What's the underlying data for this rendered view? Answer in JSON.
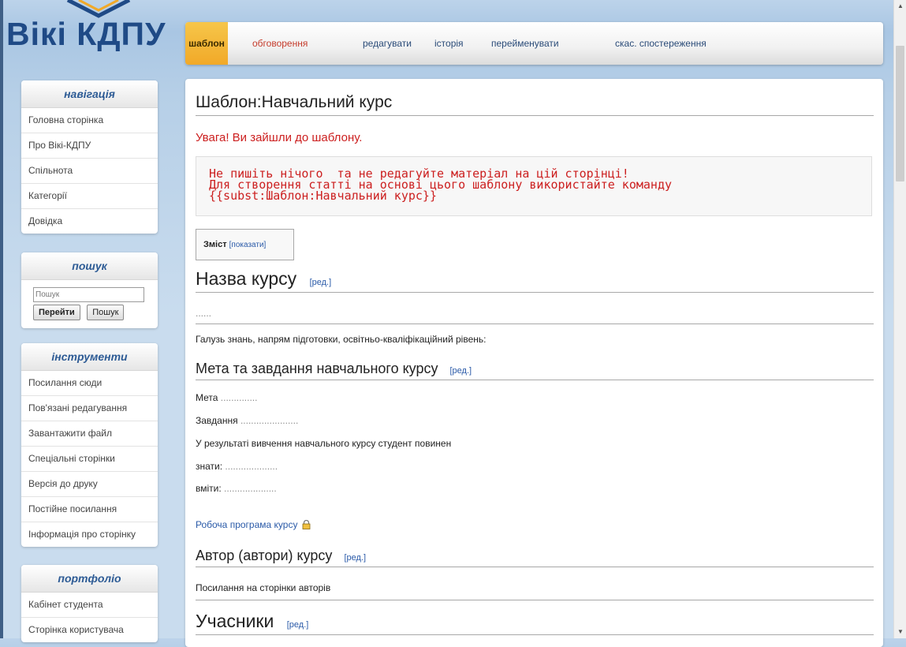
{
  "site": {
    "logo_text": "Вікі КДПУ"
  },
  "tabs": [
    {
      "label": "шаблон"
    },
    {
      "label": "обговорення"
    },
    {
      "label": "редагувати"
    },
    {
      "label": "історія"
    },
    {
      "label": "перейменувати"
    },
    {
      "label": "скас. спостереження"
    }
  ],
  "sidebar": {
    "navigation": {
      "title": "навігація",
      "items": [
        "Головна сторінка",
        "Про Вікі-КДПУ",
        "Спільнота",
        "Категорії",
        "Довідка"
      ]
    },
    "search": {
      "title": "пошук",
      "placeholder": "Пошук",
      "go_label": "Перейти",
      "search_label": "Пошук"
    },
    "tools": {
      "title": "інструменти",
      "items": [
        "Посилання сюди",
        "Пов'язані редагування",
        "Завантажити файл",
        "Спеціальні сторінки",
        "Версія до друку",
        "Постійне посилання",
        "Інформація про сторінку"
      ]
    },
    "portfolio": {
      "title": "портфоліо",
      "items": [
        "Кабінет студента",
        "Сторінка користувача"
      ]
    }
  },
  "content": {
    "title": "Шаблон:Навчальний курс",
    "warning": "Увага! Ви зайшли до шаблону.",
    "pre_lines": [
      "Не пишіть нічого  та не редагуйте матеріал на цій сторінці!",
      "Для створення статті на основі цього шаблону використайте команду",
      "{{subst:Шаблон:Навчальний курс}}"
    ],
    "toc": {
      "title": "Зміст",
      "toggle": "[показати]"
    },
    "edit_link": "[ред.]",
    "section1": {
      "heading": "Назва курсу",
      "dots": "......"
    },
    "field_line": "Галузь знань, напрям підготовки, освітньо-кваліфікаційний рівень:",
    "section2": {
      "heading": "Мета та завдання навчального курсу",
      "goal_label": "Мета",
      "goal_dots": "..............",
      "tasks_label": "Завдання",
      "tasks_dots": "......................",
      "result_line": "У результаті вивчення навчального курсу студент повинен",
      "know_label": "знати:",
      "know_dots": "....................",
      "can_label": "вміти:",
      "can_dots": "...................."
    },
    "program_link": "Робоча програма курсу",
    "section3": {
      "heading": "Автор (автори) курсу",
      "text": "Посилання на сторінки авторів"
    },
    "section4": {
      "heading": "Учасники"
    }
  },
  "colors": {
    "accent_tab": "#f1a928",
    "link": "#2a5aa8",
    "warning": "#cc1f1f",
    "logo": "#1f4a86"
  },
  "icons": [
    "lock-icon",
    "scroll-up-arrow-icon",
    "scroll-down-arrow-icon"
  ]
}
